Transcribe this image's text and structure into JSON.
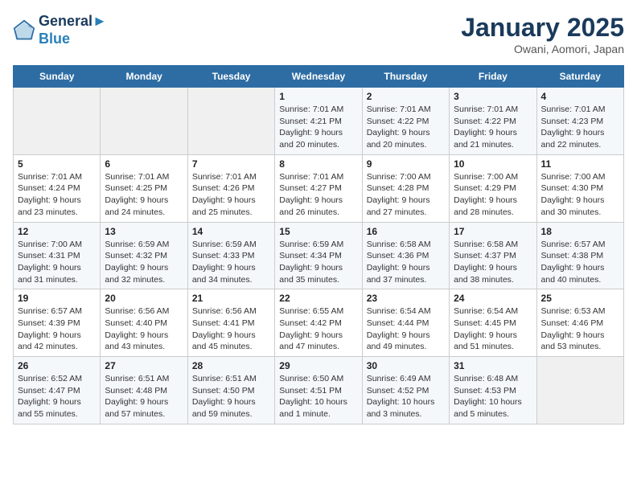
{
  "header": {
    "logo_line1": "General",
    "logo_line2": "Blue",
    "title": "January 2025",
    "subtitle": "Owani, Aomori, Japan"
  },
  "days_of_week": [
    "Sunday",
    "Monday",
    "Tuesday",
    "Wednesday",
    "Thursday",
    "Friday",
    "Saturday"
  ],
  "weeks": [
    [
      {
        "day": "",
        "info": ""
      },
      {
        "day": "",
        "info": ""
      },
      {
        "day": "",
        "info": ""
      },
      {
        "day": "1",
        "info": "Sunrise: 7:01 AM\nSunset: 4:21 PM\nDaylight: 9 hours\nand 20 minutes."
      },
      {
        "day": "2",
        "info": "Sunrise: 7:01 AM\nSunset: 4:22 PM\nDaylight: 9 hours\nand 20 minutes."
      },
      {
        "day": "3",
        "info": "Sunrise: 7:01 AM\nSunset: 4:22 PM\nDaylight: 9 hours\nand 21 minutes."
      },
      {
        "day": "4",
        "info": "Sunrise: 7:01 AM\nSunset: 4:23 PM\nDaylight: 9 hours\nand 22 minutes."
      }
    ],
    [
      {
        "day": "5",
        "info": "Sunrise: 7:01 AM\nSunset: 4:24 PM\nDaylight: 9 hours\nand 23 minutes."
      },
      {
        "day": "6",
        "info": "Sunrise: 7:01 AM\nSunset: 4:25 PM\nDaylight: 9 hours\nand 24 minutes."
      },
      {
        "day": "7",
        "info": "Sunrise: 7:01 AM\nSunset: 4:26 PM\nDaylight: 9 hours\nand 25 minutes."
      },
      {
        "day": "8",
        "info": "Sunrise: 7:01 AM\nSunset: 4:27 PM\nDaylight: 9 hours\nand 26 minutes."
      },
      {
        "day": "9",
        "info": "Sunrise: 7:00 AM\nSunset: 4:28 PM\nDaylight: 9 hours\nand 27 minutes."
      },
      {
        "day": "10",
        "info": "Sunrise: 7:00 AM\nSunset: 4:29 PM\nDaylight: 9 hours\nand 28 minutes."
      },
      {
        "day": "11",
        "info": "Sunrise: 7:00 AM\nSunset: 4:30 PM\nDaylight: 9 hours\nand 30 minutes."
      }
    ],
    [
      {
        "day": "12",
        "info": "Sunrise: 7:00 AM\nSunset: 4:31 PM\nDaylight: 9 hours\nand 31 minutes."
      },
      {
        "day": "13",
        "info": "Sunrise: 6:59 AM\nSunset: 4:32 PM\nDaylight: 9 hours\nand 32 minutes."
      },
      {
        "day": "14",
        "info": "Sunrise: 6:59 AM\nSunset: 4:33 PM\nDaylight: 9 hours\nand 34 minutes."
      },
      {
        "day": "15",
        "info": "Sunrise: 6:59 AM\nSunset: 4:34 PM\nDaylight: 9 hours\nand 35 minutes."
      },
      {
        "day": "16",
        "info": "Sunrise: 6:58 AM\nSunset: 4:36 PM\nDaylight: 9 hours\nand 37 minutes."
      },
      {
        "day": "17",
        "info": "Sunrise: 6:58 AM\nSunset: 4:37 PM\nDaylight: 9 hours\nand 38 minutes."
      },
      {
        "day": "18",
        "info": "Sunrise: 6:57 AM\nSunset: 4:38 PM\nDaylight: 9 hours\nand 40 minutes."
      }
    ],
    [
      {
        "day": "19",
        "info": "Sunrise: 6:57 AM\nSunset: 4:39 PM\nDaylight: 9 hours\nand 42 minutes."
      },
      {
        "day": "20",
        "info": "Sunrise: 6:56 AM\nSunset: 4:40 PM\nDaylight: 9 hours\nand 43 minutes."
      },
      {
        "day": "21",
        "info": "Sunrise: 6:56 AM\nSunset: 4:41 PM\nDaylight: 9 hours\nand 45 minutes."
      },
      {
        "day": "22",
        "info": "Sunrise: 6:55 AM\nSunset: 4:42 PM\nDaylight: 9 hours\nand 47 minutes."
      },
      {
        "day": "23",
        "info": "Sunrise: 6:54 AM\nSunset: 4:44 PM\nDaylight: 9 hours\nand 49 minutes."
      },
      {
        "day": "24",
        "info": "Sunrise: 6:54 AM\nSunset: 4:45 PM\nDaylight: 9 hours\nand 51 minutes."
      },
      {
        "day": "25",
        "info": "Sunrise: 6:53 AM\nSunset: 4:46 PM\nDaylight: 9 hours\nand 53 minutes."
      }
    ],
    [
      {
        "day": "26",
        "info": "Sunrise: 6:52 AM\nSunset: 4:47 PM\nDaylight: 9 hours\nand 55 minutes."
      },
      {
        "day": "27",
        "info": "Sunrise: 6:51 AM\nSunset: 4:48 PM\nDaylight: 9 hours\nand 57 minutes."
      },
      {
        "day": "28",
        "info": "Sunrise: 6:51 AM\nSunset: 4:50 PM\nDaylight: 9 hours\nand 59 minutes."
      },
      {
        "day": "29",
        "info": "Sunrise: 6:50 AM\nSunset: 4:51 PM\nDaylight: 10 hours\nand 1 minute."
      },
      {
        "day": "30",
        "info": "Sunrise: 6:49 AM\nSunset: 4:52 PM\nDaylight: 10 hours\nand 3 minutes."
      },
      {
        "day": "31",
        "info": "Sunrise: 6:48 AM\nSunset: 4:53 PM\nDaylight: 10 hours\nand 5 minutes."
      },
      {
        "day": "",
        "info": ""
      }
    ]
  ]
}
